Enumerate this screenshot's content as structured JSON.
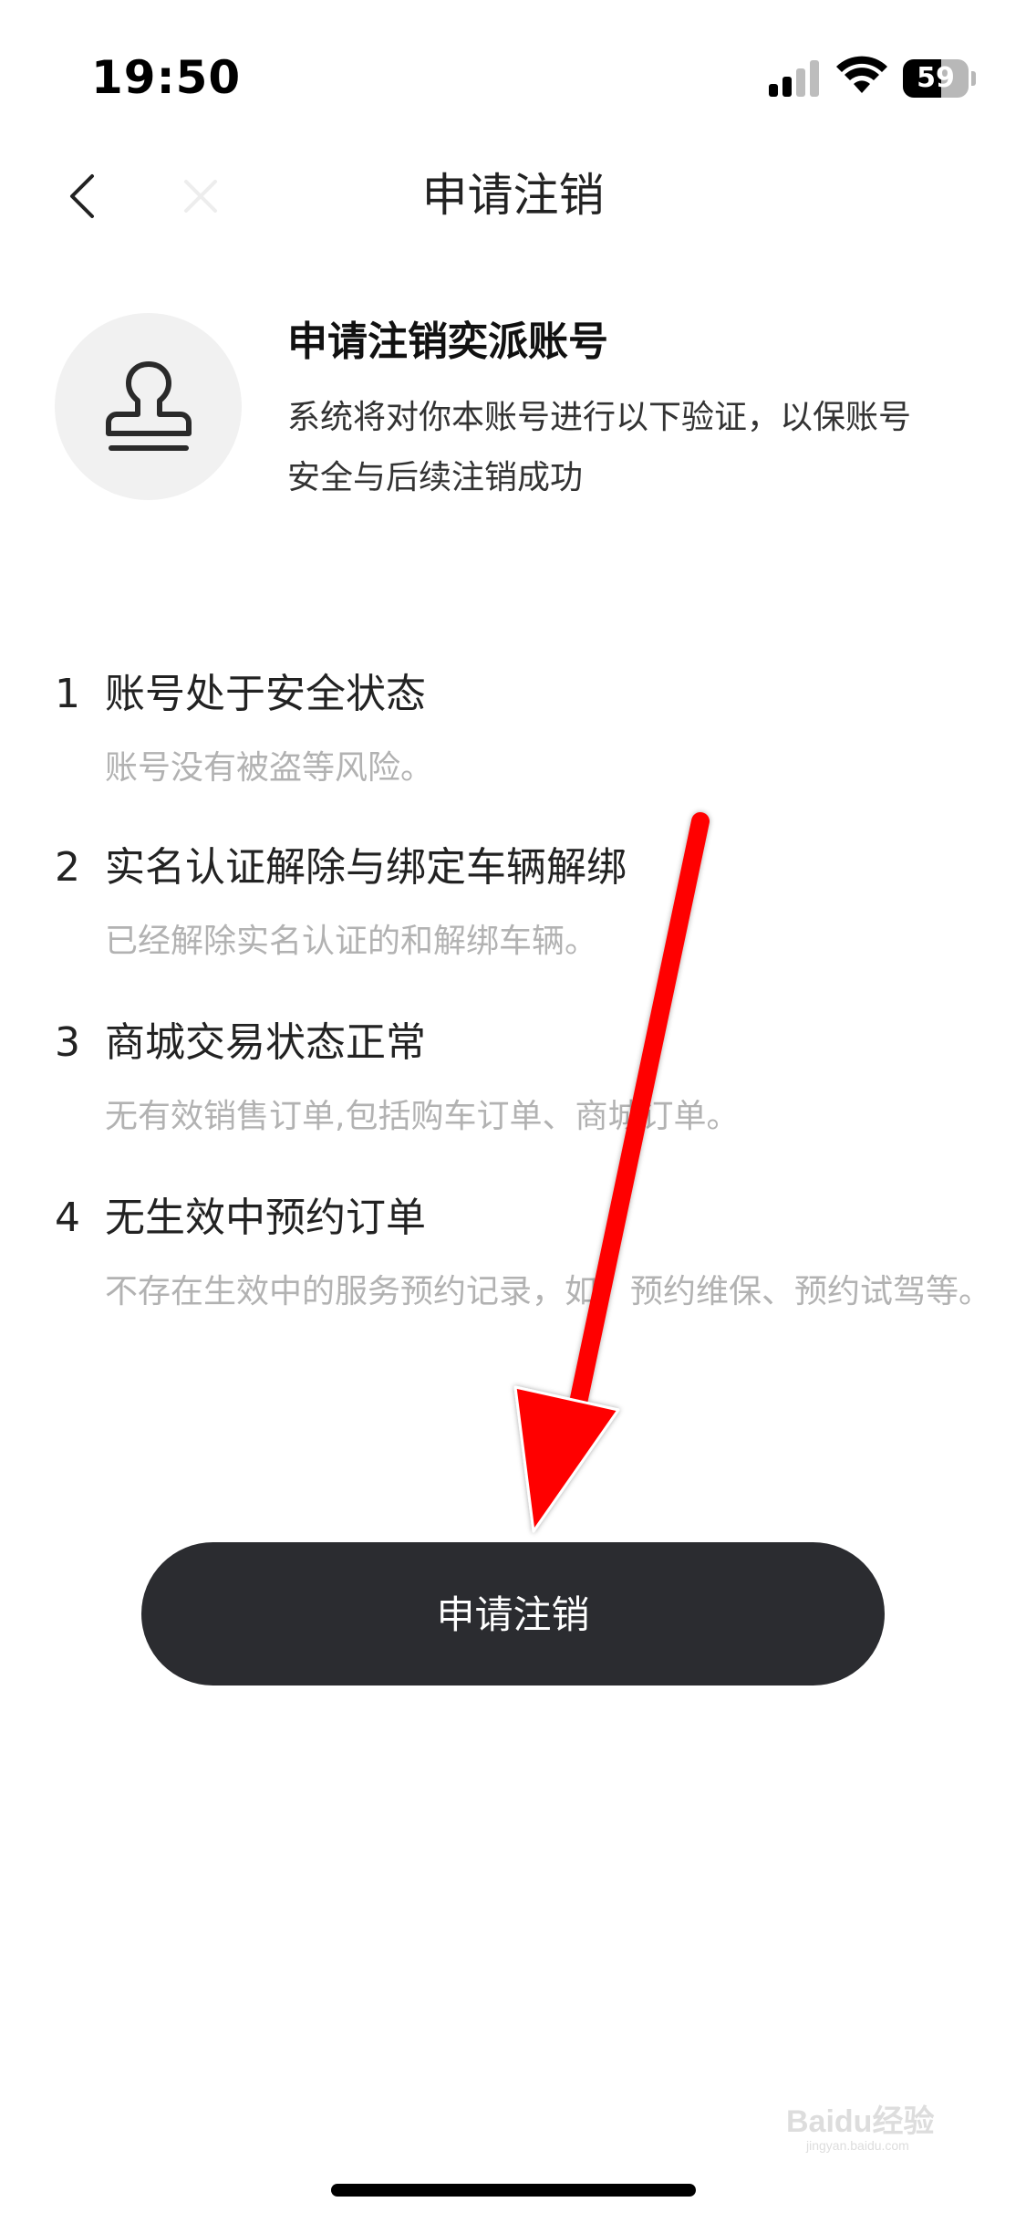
{
  "status_bar": {
    "time": "19:50",
    "battery_level": "59",
    "battery_fraction": 0.59,
    "icons": [
      "signal-icon",
      "wifi-icon",
      "battery-icon"
    ]
  },
  "nav": {
    "title": "申请注销",
    "back_icon": "chevron-left-icon",
    "close_icon": "close-icon"
  },
  "header": {
    "icon": "stamp-icon",
    "title": "申请注销奕派账号",
    "description": "系统将对你本账号进行以下验证，以保账号安全与后续注销成功"
  },
  "requirements": [
    {
      "number": "1",
      "title": "账号处于安全状态",
      "description": "账号没有被盗等风险。"
    },
    {
      "number": "2",
      "title": "实名认证解除与绑定车辆解绑",
      "description": "已经解除实名认证的和解绑车辆。"
    },
    {
      "number": "3",
      "title": "商城交易状态正常",
      "description": "无有效销售订单,包括购车订单、商城订单。"
    },
    {
      "number": "4",
      "title": "无生效中预约订单",
      "description": "不存在生效中的服务预约记录，如：预约维保、预约试驾等。"
    }
  ],
  "actions": {
    "apply_label": "申请注销"
  },
  "annotation": {
    "arrow_color": "#ff0000"
  },
  "watermark": {
    "text": "Baidu经验",
    "subtext": "jingyan.baidu.com"
  }
}
